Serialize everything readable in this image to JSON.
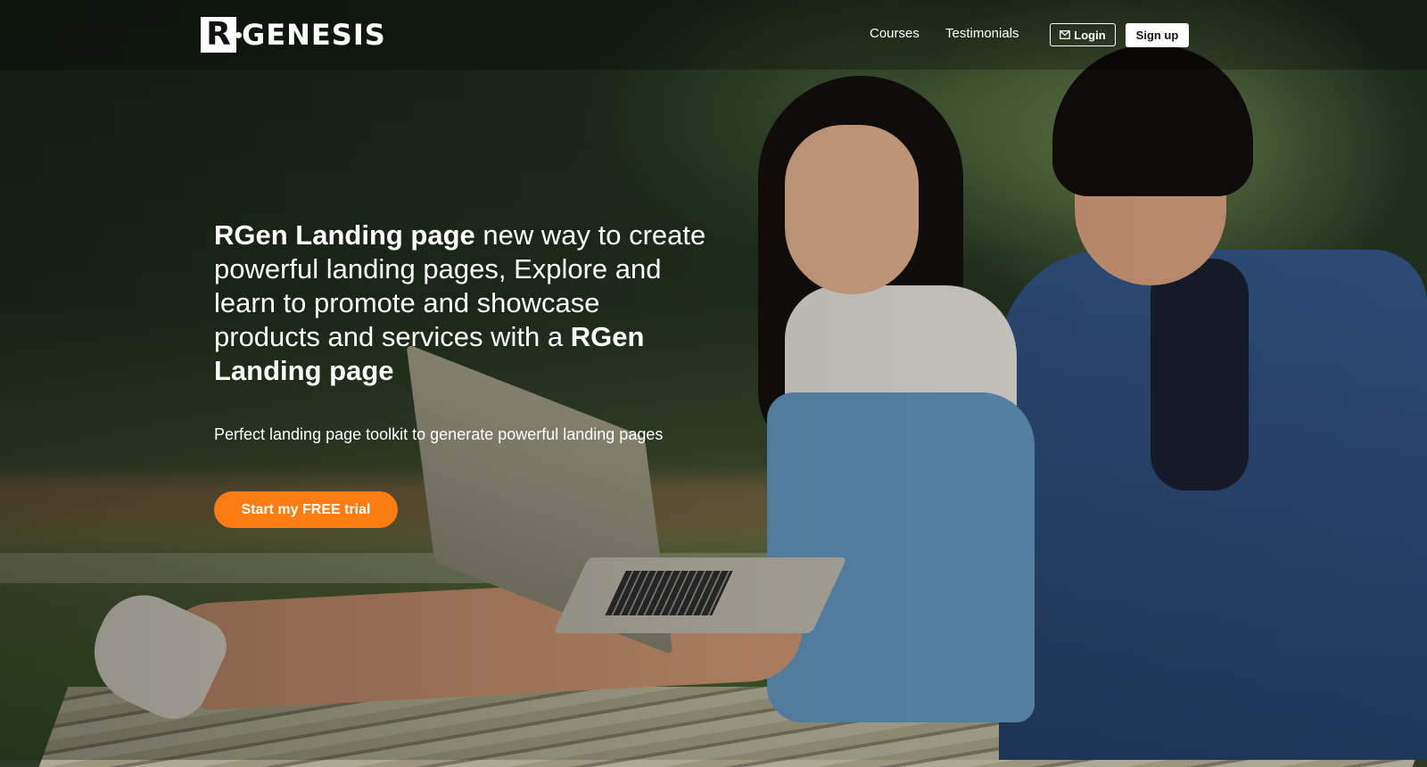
{
  "brand": {
    "logo_letter": "R",
    "logo_text": "GENESIS"
  },
  "nav": {
    "links": [
      {
        "label": "Courses"
      },
      {
        "label": "Testimonials"
      }
    ],
    "login_label": "Login",
    "signup_label": "Sign up",
    "login_icon": "envelope-icon"
  },
  "hero": {
    "headline_strong_1": "RGen Landing page",
    "headline_text": " new way to create powerful landing pages, Explore and learn to promote and showcase products and services with a ",
    "headline_strong_2": "RGen Landing page",
    "subline": "Perfect landing page toolkit to generate powerful landing pages",
    "cta_label": "Start my FREE trial"
  },
  "colors": {
    "cta": "#fb7c12",
    "text": "#ffffff"
  }
}
